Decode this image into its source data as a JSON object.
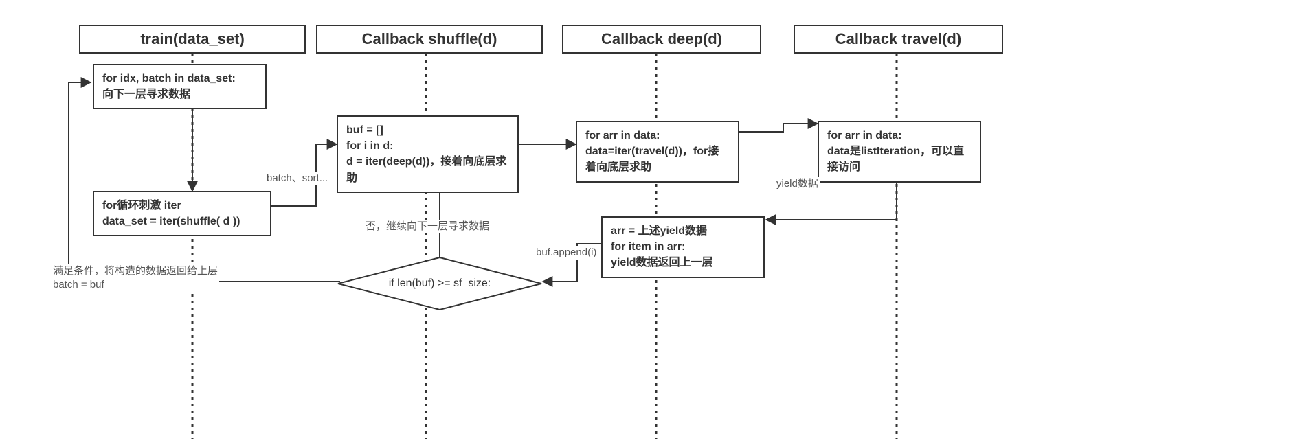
{
  "lanes": {
    "train": {
      "title": "train(data_set)"
    },
    "shuffle": {
      "title": "Callback shuffle(d)"
    },
    "deep": {
      "title": "Callback deep(d)"
    },
    "travel": {
      "title": "Callback travel(d)"
    }
  },
  "boxes": {
    "train_loop": {
      "l1": "for idx, batch in data_set:",
      "l2": "向下一层寻求数据"
    },
    "train_iter": {
      "l1": "for循环刺激 iter",
      "l2": "data_set = iter(shuffle( d ))"
    },
    "shuffle_buf": {
      "l1": "buf = []",
      "l2": "for i in d:",
      "l3a": "d = iter(deep(d))，",
      "l3b": "接着向底层求助"
    },
    "deep_loop": {
      "l1": "for arr in data:",
      "l2a": "data=iter(travel(d))，",
      "l2b": "for接着向底层求助"
    },
    "travel_loop": {
      "l1": "for arr in data:",
      "l2a": "data是listIteration，",
      "l2b": "可以直接访问"
    },
    "deep_yield": {
      "l1": "arr = 上述yield数据",
      "l2": "for item in arr:",
      "l3": "yield数据返回上一层"
    }
  },
  "decision": {
    "cond": "if len(buf) >= sf_size:"
  },
  "annotations": {
    "batch_sort": "batch、sort...",
    "no_branch": "否，继续向下一层寻求数据",
    "yield_data": "yield数据",
    "buf_append": "buf.append(i)",
    "yes_branch_l1": "满足条件，将构造的数据返回给上层",
    "yes_branch_l2": "batch = buf"
  }
}
